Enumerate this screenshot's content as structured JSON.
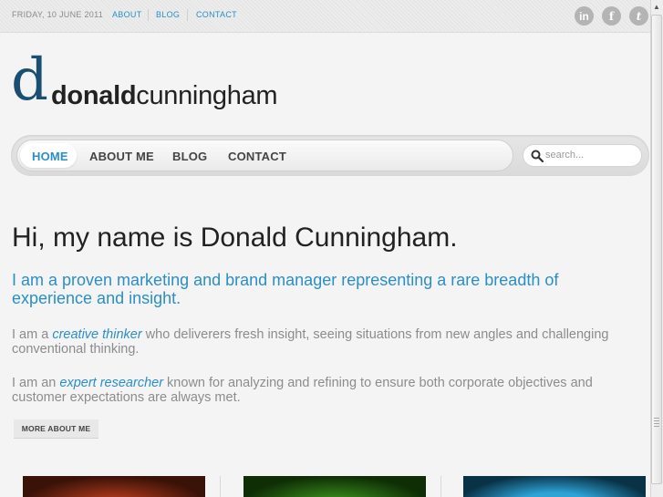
{
  "topbar": {
    "date": "FRIDAY, 10 JUNE 2011",
    "links": [
      {
        "label": "ABOUT"
      },
      {
        "label": "BLOG"
      },
      {
        "label": "CONTACT"
      }
    ],
    "social": [
      {
        "icon": "linkedin-icon",
        "glyph": "in"
      },
      {
        "icon": "facebook-icon",
        "glyph": "f"
      },
      {
        "icon": "twitter-icon",
        "glyph": "t"
      }
    ]
  },
  "logo": {
    "mark": "d",
    "first": "donald",
    "last": "cunningham",
    "mark_color": "#1b4f72"
  },
  "nav": {
    "items": [
      {
        "label": "HOME",
        "active": true
      },
      {
        "label": "ABOUT ME",
        "active": false
      },
      {
        "label": "BLOG",
        "active": false
      },
      {
        "label": "CONTACT",
        "active": false
      }
    ],
    "search_placeholder": "search..."
  },
  "content": {
    "headline": "Hi, my name is Donald Cunningham.",
    "lead": "I am a proven marketing and brand manager representing a rare breadth of experience and insight.",
    "para1": {
      "before": "I am a ",
      "emphasis": "creative thinker",
      "after": " who deliverers fresh insight, seeing situations from new angles and challenging conventional thinking."
    },
    "para2": {
      "before": "I am an ",
      "emphasis": "expert researcher",
      "after": " known for analyzing and refining to ensure both corporate objectives and customer expectations are always met."
    },
    "more_button": "MORE ABOUT ME"
  },
  "colors": {
    "accent": "#2a8fc6",
    "text": "#222222",
    "muted": "#8c8c8c"
  }
}
